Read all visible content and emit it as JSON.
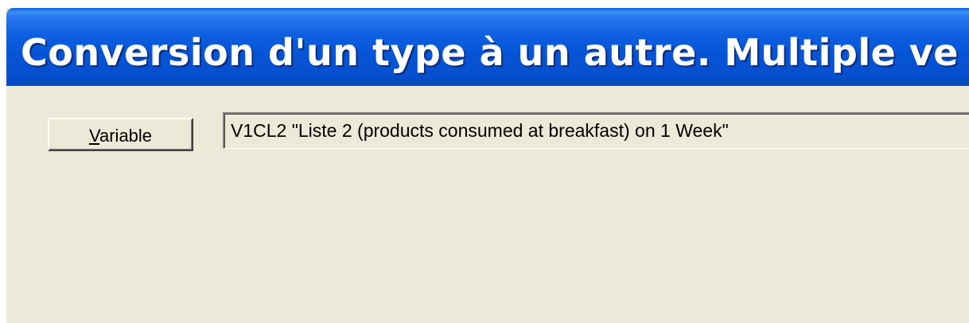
{
  "window": {
    "title": "Conversion d'un type à un autre. Multiple ve"
  },
  "variable": {
    "button_mnemonic": "V",
    "button_rest": "ariable",
    "value": "V1CL2 \"Liste 2 (products consumed at breakfast) on 1 Week\""
  },
  "colors": {
    "title_bar": "#0654d6",
    "title_text": "#ffffff",
    "dialog_background": "#ece9d8"
  }
}
